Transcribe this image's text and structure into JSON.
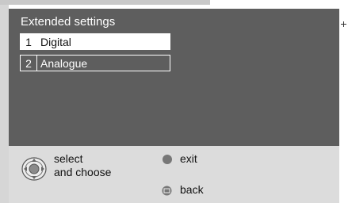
{
  "menu": {
    "title": "Extended settings",
    "items": [
      {
        "number": "1",
        "label": "Digital",
        "selected": true
      },
      {
        "number": "2",
        "label": "Analogue",
        "selected": false
      }
    ]
  },
  "footer": {
    "select_line1": "select",
    "select_line2": "and choose",
    "exit_label": "exit",
    "back_label": "back"
  },
  "colors": {
    "panel": "#5e5e5e",
    "footer": "#dcdcdc",
    "selected_bg": "#ffffff"
  }
}
